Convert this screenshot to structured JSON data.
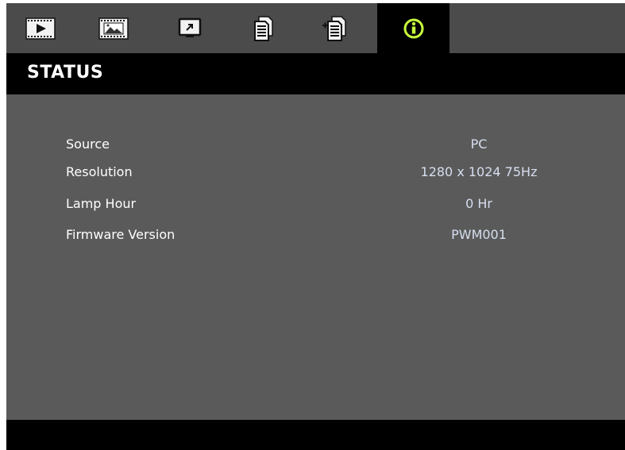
{
  "header": {
    "title": "STATUS"
  },
  "tabs": [
    {
      "icon": "video-icon",
      "active": false
    },
    {
      "icon": "image-icon",
      "active": false
    },
    {
      "icon": "display-icon",
      "active": false
    },
    {
      "icon": "document-icon",
      "active": false
    },
    {
      "icon": "document-add-icon",
      "active": false
    },
    {
      "icon": "info-icon",
      "active": true
    }
  ],
  "status": {
    "rows": [
      {
        "label": "Source",
        "value": "PC"
      },
      {
        "label": "Resolution",
        "value": "1280 x 1024 75Hz"
      },
      {
        "label": "Lamp Hour",
        "value": "0 Hr"
      },
      {
        "label": "Firmware Version",
        "value": "PWM001"
      }
    ]
  },
  "colors": {
    "background": "#5a5a5a",
    "tabbar": "#4b4b4b",
    "header": "#000000",
    "label": "#ffffff",
    "value": "#d6deee",
    "active_icon": "#c8ff3c"
  }
}
